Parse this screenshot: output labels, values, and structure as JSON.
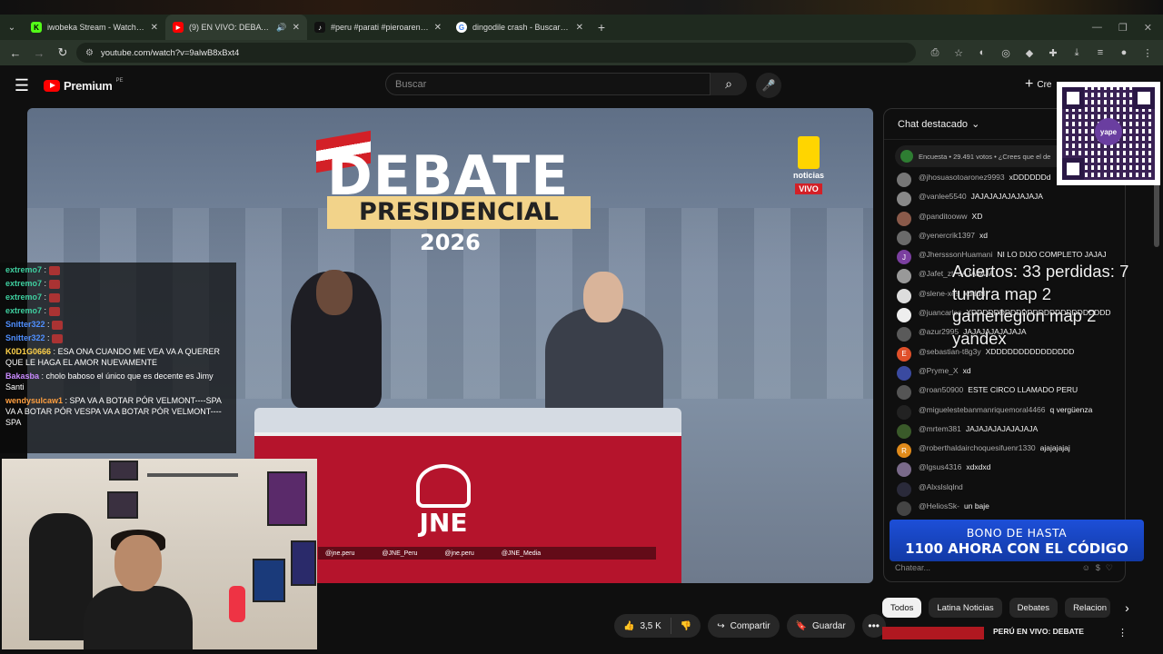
{
  "browser": {
    "tabs": [
      {
        "title": "iwobeka Stream - Watch Live o",
        "fav_color": "#53fc18",
        "fav_glyph": "K"
      },
      {
        "title": "(9) EN VIVO: DEBATE PRESI",
        "fav_color": "#ff0000",
        "fav_glyph": "▶",
        "active": true
      },
      {
        "title": "#peru #parati #pieroarenas #",
        "fav_color": "#111111",
        "fav_glyph": "♪"
      },
      {
        "title": "dingodile crash - Buscar con G",
        "fav_color": "#ffffff",
        "fav_glyph": "G"
      }
    ],
    "url": "youtube.com/watch?v=9alwB8xBxt4"
  },
  "yt": {
    "brand": "Premium",
    "country": "PE",
    "search_placeholder": "Buscar",
    "create_label": "Cre"
  },
  "video": {
    "title_main": "DEBATE",
    "title_sub": "PRESIDENCIAL",
    "title_year": "2026",
    "channel_name": "noticias",
    "live_badge": "VIVO",
    "org": "JNE",
    "socials": [
      "@jne.peru",
      "@JNE_Peru",
      "@jne.peru",
      "@JNE_Media"
    ]
  },
  "overlay_chat": [
    {
      "user": "extremo7",
      "text": "",
      "color": "#3fd0a0"
    },
    {
      "user": "extremo7",
      "text": "",
      "color": "#3fd0a0"
    },
    {
      "user": "extremo7",
      "text": "",
      "color": "#3fd0a0"
    },
    {
      "user": "extremo7",
      "text": "",
      "color": "#3fd0a0"
    },
    {
      "user": "Snitter322",
      "text": "",
      "color": "#4f8fff"
    },
    {
      "user": "Snitter322",
      "text": "",
      "color": "#4f8fff"
    },
    {
      "user": "K0D1G0666",
      "text": "ESA ONA CUANDO ME VEA VA A QUERER QUE LE HAGA EL AMOR NUEVAMENTE",
      "color": "#ffd24a"
    },
    {
      "user": "Bakasba",
      "text": "cholo baboso el único que es decente es Jimy Santi",
      "color": "#c98aff"
    },
    {
      "user": "wendysulcaw1",
      "text": "SPA VA A BOTAR PÓR VELMONT----SPA VA A BOTAR PÓR VESPA VA A BOTAR PÓR VELMONT----SPA",
      "color": "#ff9f40"
    }
  ],
  "actions": {
    "likes": "3,5 K",
    "share": "Compartir",
    "save": "Guardar"
  },
  "chat": {
    "header": "Chat destacado",
    "poll": "Encuesta • 29.491 votos • ¿Crees que el de",
    "input_placeholder": "Chatear...",
    "messages": [
      {
        "user": "@jhosuasotoaronez9993",
        "text": "xDDDDDDd",
        "av": "",
        "av_color": "#777"
      },
      {
        "user": "@vanlee5540",
        "text": "JAJAJAJAJAJAJAJA",
        "av": "",
        "av_color": "#888"
      },
      {
        "user": "@panditooww",
        "text": "XD",
        "av": "",
        "av_color": "#8a5a4a"
      },
      {
        "user": "@yenercrik1397",
        "text": "xd",
        "av": "",
        "av_color": "#6a6a6a"
      },
      {
        "user": "@JhersssonHuamani",
        "text": "NI LO DIJO COMPLETO JAJAJ",
        "av": "J",
        "av_color": "#7b3fa0"
      },
      {
        "user": "@Jafet_zt",
        "text": "JAJAJAJA",
        "av": "",
        "av_color": "#999"
      },
      {
        "user": "@slene-xes",
        "text": "xdddd",
        "av": "",
        "av_color": "#ddd"
      },
      {
        "user": "@juancarlos",
        "text": "XDDDDDDDDDDDDDDDDDDDDDDDDD",
        "av": "",
        "av_color": "#eee"
      },
      {
        "user": "@azur2995",
        "text": "JAJAJAJAJAJAJA",
        "av": "",
        "av_color": "#5a5a5a"
      },
      {
        "user": "@sebastian-t8g3y",
        "text": "XDDDDDDDDDDDDDDD",
        "av": "E",
        "av_color": "#e0502a"
      },
      {
        "user": "@Pryme_X",
        "text": "xd",
        "av": "",
        "av_color": "#3a4aa0"
      },
      {
        "user": "@roan50900",
        "text": "ESTE CIRCO LLAMADO PERU",
        "av": "",
        "av_color": "#555"
      },
      {
        "user": "@miguelestebanmanriquemoral4466",
        "text": "q vergüenza",
        "av": "",
        "av_color": "#222"
      },
      {
        "user": "@mrtem381",
        "text": "JAJAJAJAJAJAJAJA",
        "av": "",
        "av_color": "#3a5a2a"
      },
      {
        "user": "@roberthaldairchoquesifuenr1330",
        "text": "ajajajajaj",
        "av": "R",
        "av_color": "#e08a1a"
      },
      {
        "user": "@lgsus4316",
        "text": "xdxdxd",
        "av": "",
        "av_color": "#7a6a8a"
      },
      {
        "user": "@Alxslslqlnd",
        "text": "",
        "av": "",
        "av_color": "#2a2a3a"
      },
      {
        "user": "@HeliosSk-",
        "text": "un baje",
        "av": "",
        "av_color": "#444"
      }
    ]
  },
  "stream_overlay": {
    "stats": "Aciertos: 33 perdidas: 7",
    "line2": "tundra map 2",
    "line3": "gamerlegion map 2",
    "line4": "yandex",
    "promo_line1": "BONO DE HASTA",
    "promo_line2": "1100 AHORA CON EL CÓDIGO",
    "qr_brand": "yape"
  },
  "chips": [
    "Todos",
    "Latina Noticias",
    "Debates",
    "Relacion"
  ],
  "related": {
    "title": "PERÚ EN VIVO: DEBATE"
  },
  "colors": {
    "accent": "#ff0000",
    "bg": "#0f0f0f"
  }
}
